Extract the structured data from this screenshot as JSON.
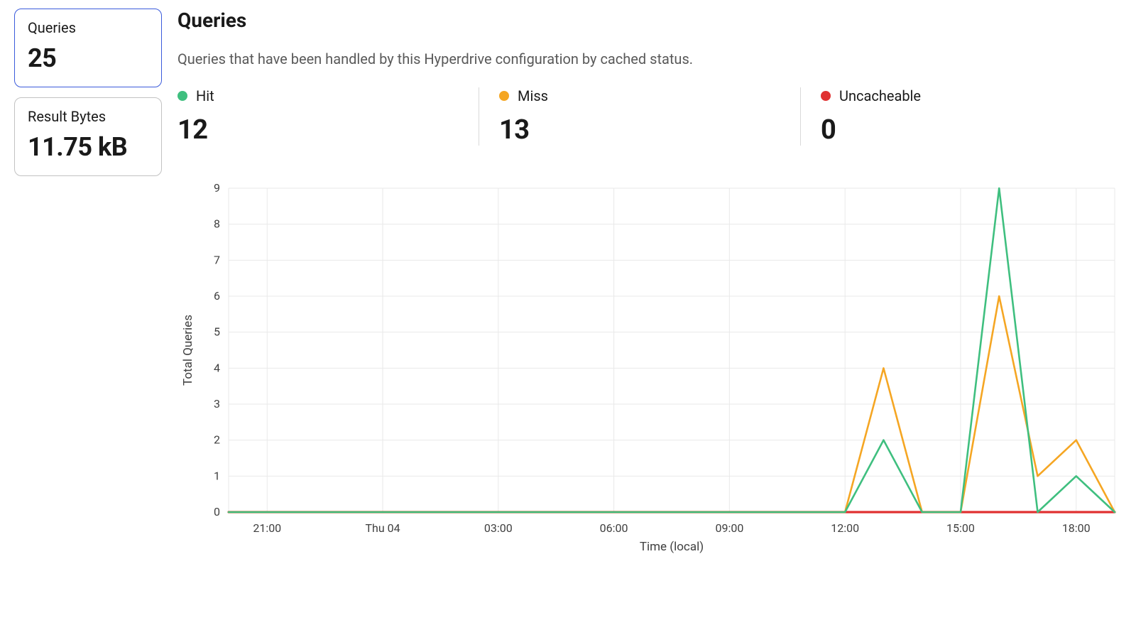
{
  "sidebar": {
    "cards": [
      {
        "label": "Queries",
        "value": "25",
        "active": true
      },
      {
        "label": "Result Bytes",
        "value": "11.75 kB",
        "active": false
      }
    ]
  },
  "panel": {
    "title": "Queries",
    "description": "Queries that have been handled by this Hyperdrive configuration by cached status."
  },
  "stats": [
    {
      "dot": "#3fbf7f",
      "label": "Hit",
      "value": "12"
    },
    {
      "dot": "#f5a623",
      "label": "Miss",
      "value": "13"
    },
    {
      "dot": "#e03131",
      "label": "Uncacheable",
      "value": "0"
    }
  ],
  "colors": {
    "hit": "#3fbf7f",
    "miss": "#f5a623",
    "uncacheable": "#e03131"
  },
  "chart_data": {
    "type": "line",
    "title": "",
    "xlabel": "Time (local)",
    "ylabel": "Total Queries",
    "ylim": [
      0,
      9
    ],
    "yticks": [
      0,
      1,
      2,
      3,
      4,
      5,
      6,
      7,
      8,
      9
    ],
    "x_tick_labels": [
      "21:00",
      "Thu 04",
      "03:00",
      "06:00",
      "09:00",
      "12:00",
      "15:00",
      "18:00"
    ],
    "x_tick_indices": [
      1,
      4,
      7,
      10,
      13,
      16,
      19,
      22
    ],
    "x_count": 24,
    "categories": [
      "20:00",
      "21:00",
      "22:00",
      "23:00",
      "Thu 04",
      "01:00",
      "02:00",
      "03:00",
      "04:00",
      "05:00",
      "06:00",
      "07:00",
      "08:00",
      "09:00",
      "10:00",
      "11:00",
      "12:00",
      "13:00",
      "14:00",
      "15:00",
      "16:00",
      "17:00",
      "18:00",
      "19:00"
    ],
    "series": [
      {
        "name": "Hit",
        "color": "#3fbf7f",
        "values": [
          0,
          0,
          0,
          0,
          0,
          0,
          0,
          0,
          0,
          0,
          0,
          0,
          0,
          0,
          0,
          0,
          0,
          2,
          0,
          0,
          9,
          0,
          1,
          0
        ]
      },
      {
        "name": "Miss",
        "color": "#f5a623",
        "values": [
          0,
          0,
          0,
          0,
          0,
          0,
          0,
          0,
          0,
          0,
          0,
          0,
          0,
          0,
          0,
          0,
          0,
          4,
          0,
          0,
          6,
          1,
          2,
          0
        ]
      },
      {
        "name": "Uncacheable",
        "color": "#e03131",
        "values": [
          0,
          0,
          0,
          0,
          0,
          0,
          0,
          0,
          0,
          0,
          0,
          0,
          0,
          0,
          0,
          0,
          0,
          0,
          0,
          0,
          0,
          0,
          0,
          0
        ]
      }
    ]
  }
}
